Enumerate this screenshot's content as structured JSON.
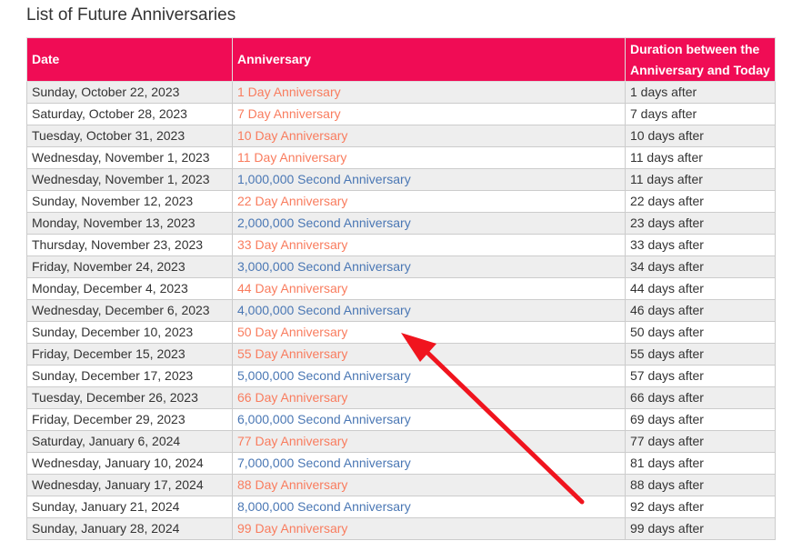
{
  "page": {
    "title": "List of Future Anniversaries"
  },
  "table": {
    "headers": {
      "date": "Date",
      "anniversary": "Anniversary",
      "duration": "Duration between the Anniversary and Today"
    },
    "rows": [
      {
        "date": "Sunday, October 22, 2023",
        "anniversary": "1 Day Anniversary",
        "type": "day",
        "duration": "1 days after"
      },
      {
        "date": "Saturday, October 28, 2023",
        "anniversary": "7 Day Anniversary",
        "type": "day",
        "duration": "7 days after"
      },
      {
        "date": "Tuesday, October 31, 2023",
        "anniversary": "10 Day Anniversary",
        "type": "day",
        "duration": "10 days after"
      },
      {
        "date": "Wednesday, November 1, 2023",
        "anniversary": "11 Day Anniversary",
        "type": "day",
        "duration": "11 days after"
      },
      {
        "date": "Wednesday, November 1, 2023",
        "anniversary": "1,000,000 Second Anniversary",
        "type": "second",
        "duration": "11 days after"
      },
      {
        "date": "Sunday, November 12, 2023",
        "anniversary": "22 Day Anniversary",
        "type": "day",
        "duration": "22 days after"
      },
      {
        "date": "Monday, November 13, 2023",
        "anniversary": "2,000,000 Second Anniversary",
        "type": "second",
        "duration": "23 days after"
      },
      {
        "date": "Thursday, November 23, 2023",
        "anniversary": "33 Day Anniversary",
        "type": "day",
        "duration": "33 days after"
      },
      {
        "date": "Friday, November 24, 2023",
        "anniversary": "3,000,000 Second Anniversary",
        "type": "second",
        "duration": "34 days after"
      },
      {
        "date": "Monday, December 4, 2023",
        "anniversary": "44 Day Anniversary",
        "type": "day",
        "duration": "44 days after"
      },
      {
        "date": "Wednesday, December 6, 2023",
        "anniversary": "4,000,000 Second Anniversary",
        "type": "second",
        "duration": "46 days after"
      },
      {
        "date": "Sunday, December 10, 2023",
        "anniversary": "50 Day Anniversary",
        "type": "day",
        "duration": "50 days after"
      },
      {
        "date": "Friday, December 15, 2023",
        "anniversary": "55 Day Anniversary",
        "type": "day",
        "duration": "55 days after"
      },
      {
        "date": "Sunday, December 17, 2023",
        "anniversary": "5,000,000 Second Anniversary",
        "type": "second",
        "duration": "57 days after"
      },
      {
        "date": "Tuesday, December 26, 2023",
        "anniversary": "66 Day Anniversary",
        "type": "day",
        "duration": "66 days after"
      },
      {
        "date": "Friday, December 29, 2023",
        "anniversary": "6,000,000 Second Anniversary",
        "type": "second",
        "duration": "69 days after"
      },
      {
        "date": "Saturday, January 6, 2024",
        "anniversary": "77 Day Anniversary",
        "type": "day",
        "duration": "77 days after"
      },
      {
        "date": "Wednesday, January 10, 2024",
        "anniversary": "7,000,000 Second Anniversary",
        "type": "second",
        "duration": "81 days after"
      },
      {
        "date": "Wednesday, January 17, 2024",
        "anniversary": "88 Day Anniversary",
        "type": "day",
        "duration": "88 days after"
      },
      {
        "date": "Sunday, January 21, 2024",
        "anniversary": "8,000,000 Second Anniversary",
        "type": "second",
        "duration": "92 days after"
      },
      {
        "date": "Sunday, January 28, 2024",
        "anniversary": "99 Day Anniversary",
        "type": "day",
        "duration": "99 days after"
      }
    ]
  },
  "annotation": {
    "type": "arrow",
    "color": "#f0141e",
    "points_to_row": 11
  },
  "colors": {
    "header_bg": "#f00c55",
    "day_anniversary": "#f97c5e",
    "second_anniversary": "#4a77b4"
  }
}
